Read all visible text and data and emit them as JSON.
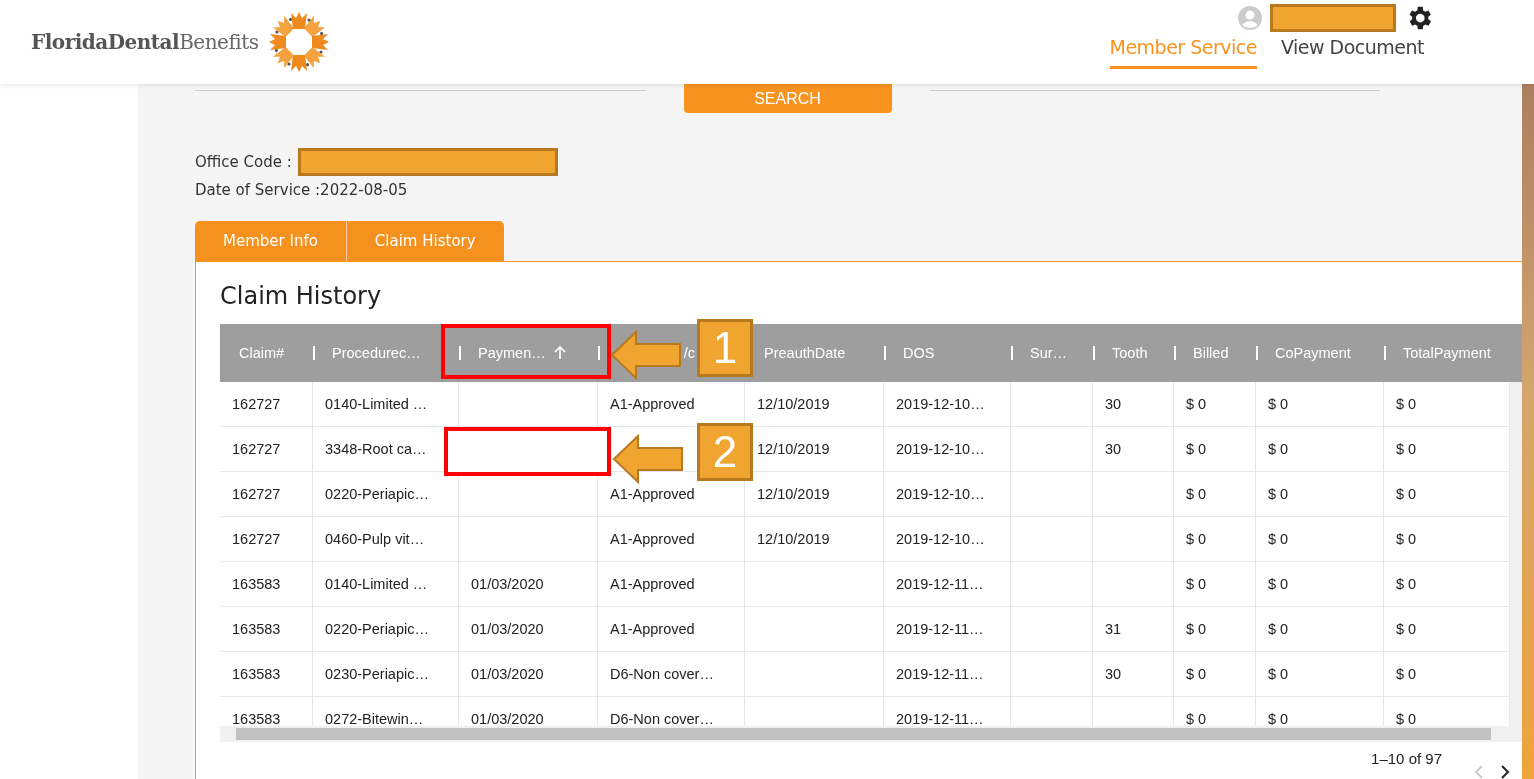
{
  "logo": {
    "bold": "FloridaDental",
    "light": "Benefits"
  },
  "nav": [
    {
      "label": "Member Service",
      "selected": true
    },
    {
      "label": "View Document",
      "selected": false
    }
  ],
  "search_button": "SEARCH",
  "info": [
    {
      "label": "Office Code :",
      "redacted": true
    },
    {
      "label": "Date of Service :",
      "value": "2022-08-05",
      "redacted": false
    }
  ],
  "tabs": [
    {
      "label": "Member Info"
    },
    {
      "label": "Claim History"
    }
  ],
  "panel_title": "Claim History",
  "table": {
    "columns": [
      {
        "label": "Claim#",
        "sorted": false
      },
      {
        "label": "Procedurec…",
        "sorted": false
      },
      {
        "label": "Paymen…",
        "sorted": true
      },
      {
        "label": "/c",
        "sorted": false
      },
      {
        "label": "PreauthDate",
        "sorted": false
      },
      {
        "label": "DOS",
        "sorted": false
      },
      {
        "label": "Sur…",
        "sorted": false
      },
      {
        "label": "Tooth",
        "sorted": false
      },
      {
        "label": "Billed",
        "sorted": false
      },
      {
        "label": "CoPayment",
        "sorted": false
      },
      {
        "label": "TotalPayment",
        "sorted": false
      }
    ],
    "rows": [
      [
        "162727",
        "0140-Limited …",
        "",
        "A1-Approved",
        "12/10/2019",
        "2019-12-10…",
        "",
        "30",
        "$ 0",
        "$ 0",
        "$ 0"
      ],
      [
        "162727",
        "3348-Root ca…",
        "",
        "",
        "12/10/2019",
        "2019-12-10…",
        "",
        "30",
        "$ 0",
        "$ 0",
        "$ 0"
      ],
      [
        "162727",
        "0220-Periapic…",
        "",
        "A1-Approved",
        "12/10/2019",
        "2019-12-10…",
        "",
        "",
        "$ 0",
        "$ 0",
        "$ 0"
      ],
      [
        "162727",
        "0460-Pulp vit…",
        "",
        "A1-Approved",
        "12/10/2019",
        "2019-12-10…",
        "",
        "",
        "$ 0",
        "$ 0",
        "$ 0"
      ],
      [
        "163583",
        "0140-Limited …",
        "01/03/2020",
        "A1-Approved",
        "",
        "2019-12-11…",
        "",
        "",
        "$ 0",
        "$ 0",
        "$ 0"
      ],
      [
        "163583",
        "0220-Periapic…",
        "01/03/2020",
        "A1-Approved",
        "",
        "2019-12-11…",
        "",
        "31",
        "$ 0",
        "$ 0",
        "$ 0"
      ],
      [
        "163583",
        "0230-Periapic…",
        "01/03/2020",
        "D6-Non cover…",
        "",
        "2019-12-11…",
        "",
        "30",
        "$ 0",
        "$ 0",
        "$ 0"
      ],
      [
        "163583",
        "0272-Bitewin…",
        "01/03/2020",
        "D6-Non cover…",
        "",
        "2019-12-11…",
        "",
        "",
        "$ 0",
        "$ 0",
        "$ 0"
      ]
    ]
  },
  "pagination": "1–10 of 97",
  "callouts": [
    {
      "number": "1"
    },
    {
      "number": "2"
    }
  ]
}
